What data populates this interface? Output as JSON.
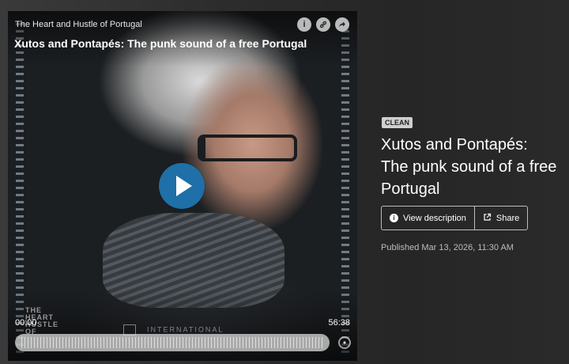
{
  "player": {
    "show_name": "The Heart and Hustle of Portugal",
    "episode_title": "Xutos and Pontapés: The punk sound of a free Portugal",
    "icons": [
      "info-icon",
      "link-icon",
      "share-icon"
    ],
    "icon_glyphs": {
      "info": "i",
      "link": "🔗",
      "share": "➦"
    },
    "current_time": "00:00",
    "total_time": "56:38",
    "progress": 0,
    "watermark_lines": [
      "THE",
      "HEART",
      "HUSTLE",
      "OF"
    ],
    "watermark_brand": "INTERNATIONAL",
    "accent_color": "#1f6fa8"
  },
  "details": {
    "badge": "CLEAN",
    "title": "Xutos and Pontapés: The punk sound of a free Portugal",
    "view_description_label": "View description",
    "share_label": "Share",
    "published": "Published Mar 13, 2026, 11:30 AM"
  }
}
